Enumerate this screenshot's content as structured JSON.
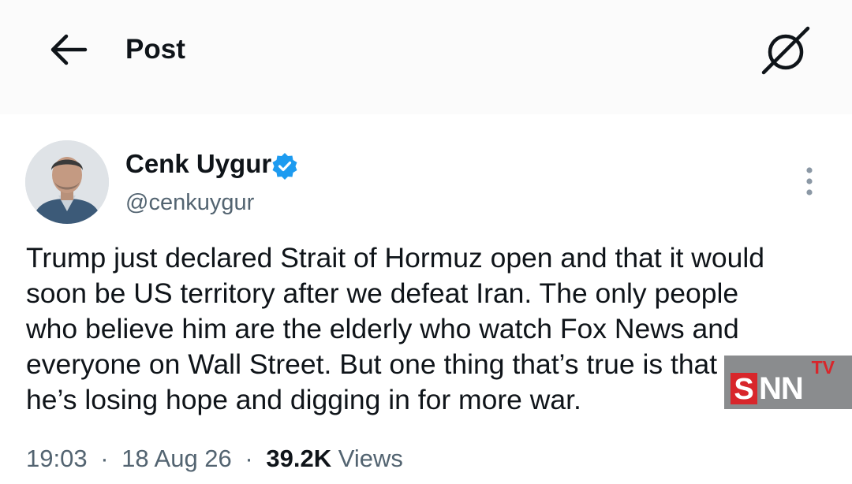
{
  "header": {
    "title": "Post",
    "back_icon": "arrow-left-icon",
    "grok_icon": "grok-icon"
  },
  "post": {
    "author_name": "Cenk Uygur",
    "author_handle": "@cenkuygur",
    "verified_color": "#1d9bf0",
    "text": "Trump just declared Strait of Hormuz open and that it would\nsoon be US territory after we defeat Iran. The only people\nwho believe him are the elderly who watch Fox News and\neveryone on Wall Street. But one thing that’s true is that\nhe’s losing hope and digging in for more war.",
    "time": "19:03",
    "date": "18 Aug 26",
    "separator": "·",
    "views_count": "39.2K",
    "views_label": "Views"
  },
  "watermark": {
    "tv": "TV",
    "s": "S",
    "nn": "NN"
  },
  "colors": {
    "text": "#0f1419",
    "secondary": "#536471",
    "accent": "#1d9bf0"
  }
}
